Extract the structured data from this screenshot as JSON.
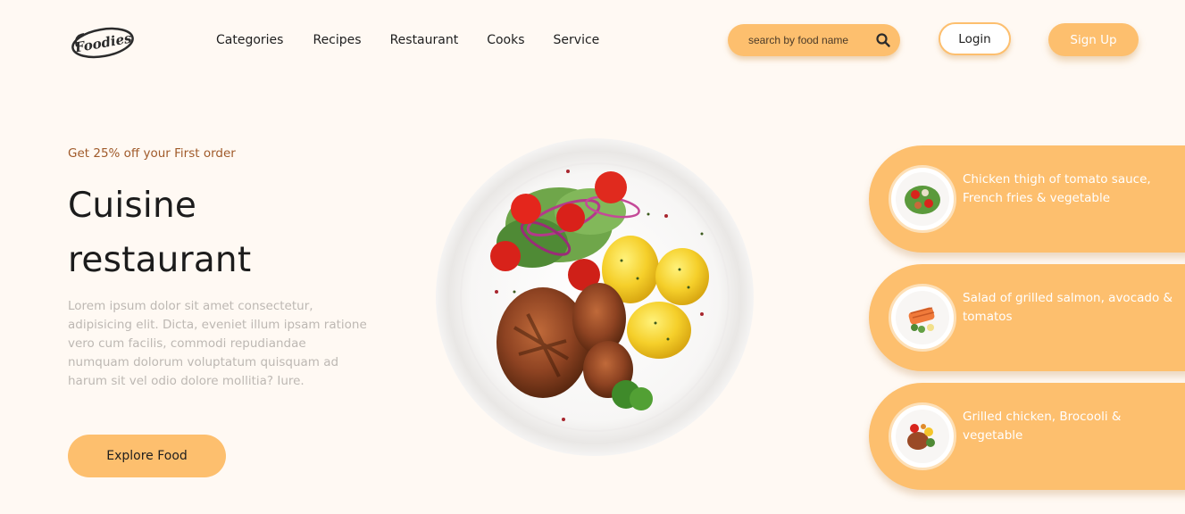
{
  "brand": {
    "logo_text": "Foodies"
  },
  "nav": {
    "links": [
      "Categories",
      "Recipes",
      "Restaurant",
      "Cooks",
      "Service"
    ]
  },
  "search": {
    "placeholder": "search by food name",
    "icon": "search-icon"
  },
  "auth": {
    "login_label": "Login",
    "signup_label": "Sign Up"
  },
  "hero": {
    "promo": "Get 25% off your First order",
    "title_line1": "Cuisine",
    "title_line2": "restaurant",
    "description": "Lorem ipsum dolor sit amet consectetur, adipisicing elit. Dicta, eveniet illum ipsam ratione vero cum facilis, commodi repudiandae numquam dolorum voluptatum quisquam ad harum sit vel odio dolore mollitia? Iure.",
    "cta_label": "Explore Food"
  },
  "cards": [
    {
      "title": "Chicken thigh of tomato sauce, French fries & vegetable"
    },
    {
      "title": "Salad of grilled salmon, avocado & tomatos"
    },
    {
      "title": "Grilled chicken, Brocooli & vegetable"
    }
  ],
  "colors": {
    "accent": "#fdbf6e",
    "background": "#fff9f3",
    "promo_text": "#a05a2a",
    "muted_text": "#bdb8b3"
  }
}
